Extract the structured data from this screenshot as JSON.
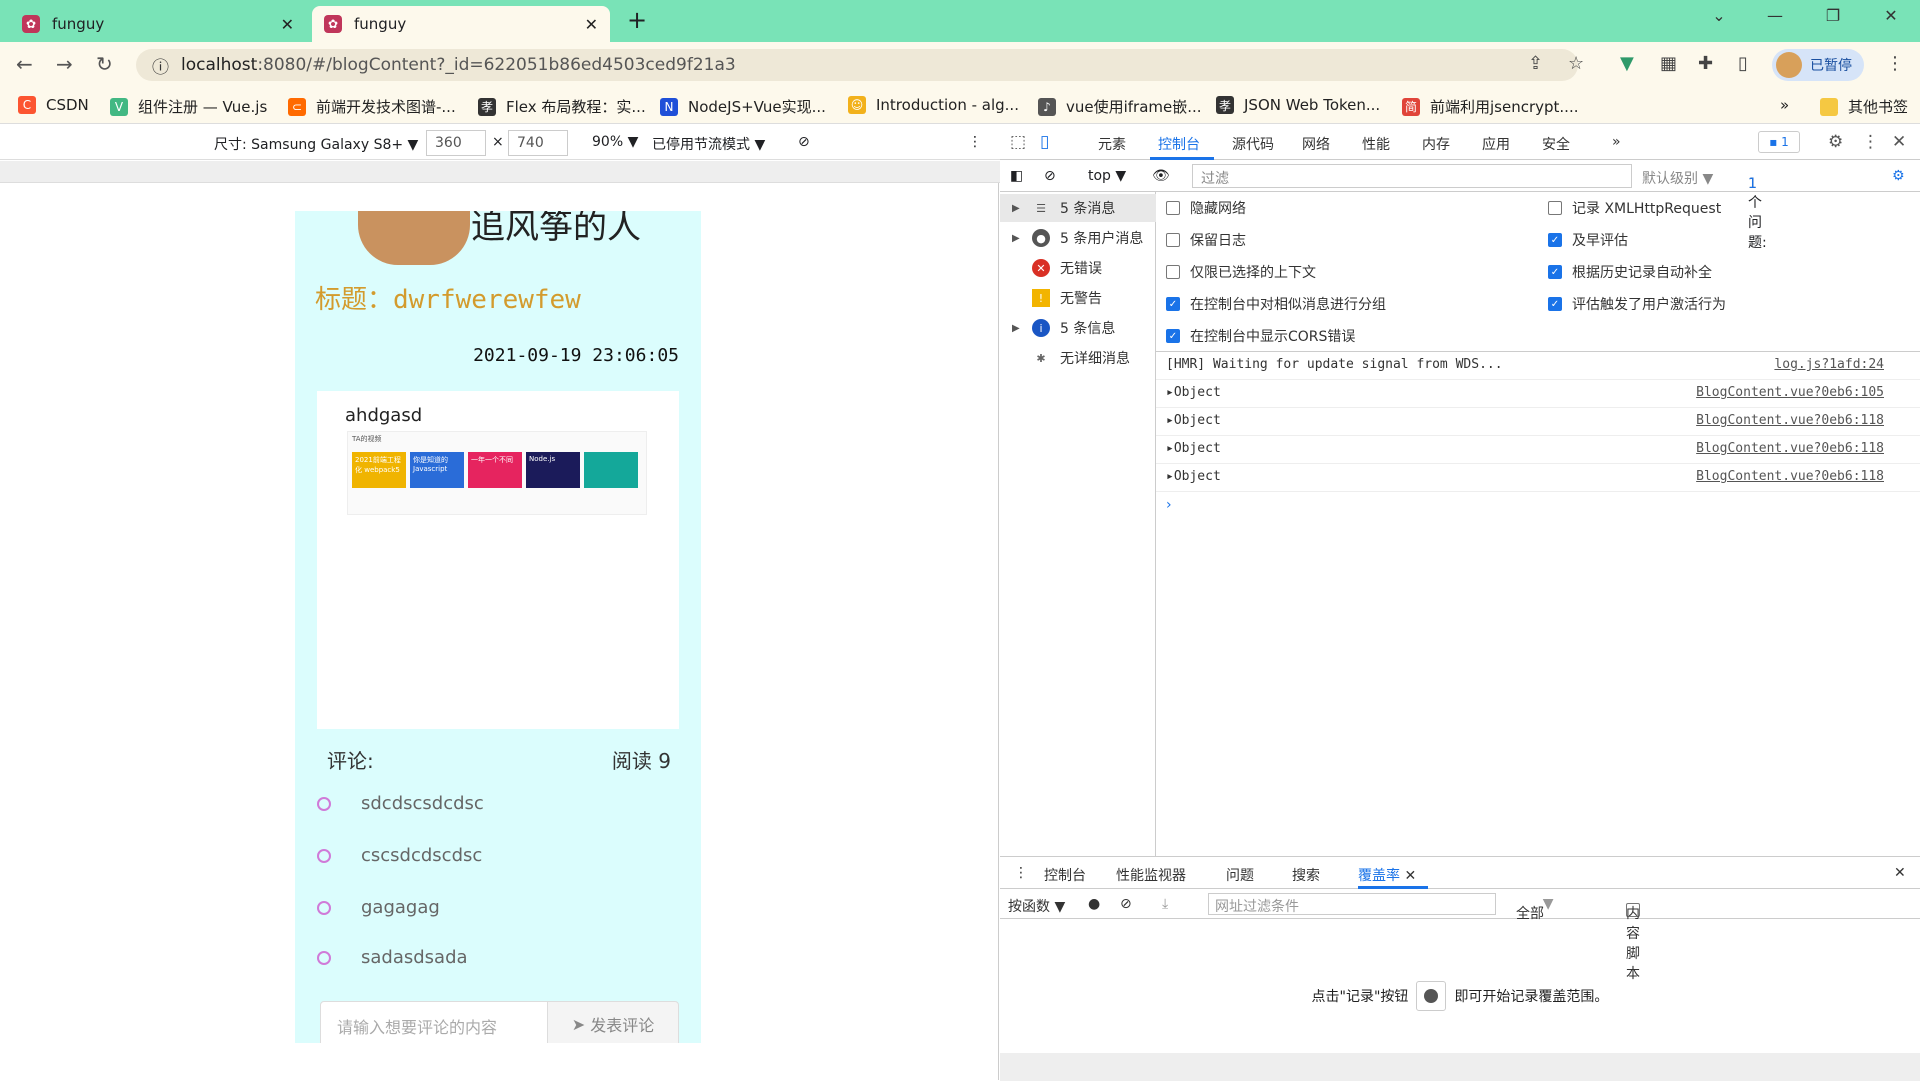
{
  "browser": {
    "tabs": [
      {
        "title": "funguy",
        "active": false
      },
      {
        "title": "funguy",
        "active": true
      }
    ],
    "url_host": "localhost",
    "url_path": ":8080/#/blogContent?_id=622051b86ed4503ced9f21a3",
    "profile_label": "已暂停",
    "bookmarks": [
      {
        "label": "CSDN",
        "color": "#fc5531"
      },
      {
        "label": "组件注册 — Vue.js",
        "color": "#42b883"
      },
      {
        "label": "前端开发技术图谱-...",
        "color": "#ff6a00"
      },
      {
        "label": "Flex 布局教程：实...",
        "color": "#333333"
      },
      {
        "label": "NodeJS+Vue实现...",
        "color": "#1f4fd8"
      },
      {
        "label": "Introduction - alg...",
        "color": "#f2b11b"
      },
      {
        "label": "vue使用iframe嵌...",
        "color": "#555555"
      },
      {
        "label": "JSON Web Token...",
        "color": "#333333"
      },
      {
        "label": "前端利用jsencrypt....",
        "color": "#e0453a"
      }
    ],
    "bookmarks_more": "»",
    "other_bookmarks": "其他书签"
  },
  "device_toolbar": {
    "device": "尺寸: Samsung Galaxy S8+ ▼",
    "width": "360",
    "height": "740",
    "times": "×",
    "zoom": "90% ▼",
    "throttle": "已停用节流模式 ▼"
  },
  "blog": {
    "author": "追风筝的人",
    "title": "标题：dwrfwerewfew",
    "date": "2021-09-19 23:06:05",
    "content_text": "ahdgasd",
    "comments_label": "评论:",
    "reads": "阅读 9",
    "comments": [
      "sdcdscsdcdsc",
      "cscsdcdscdsc",
      "gagagag",
      "sadasdsada"
    ],
    "input_placeholder": "请输入想要评论的内容",
    "submit_label": "发表评论",
    "thumb_header": "TA的视频",
    "thumbs": [
      {
        "label": "2021前端工程化 webpack5",
        "color": "#f0b400"
      },
      {
        "label": "你是知道的 Javascript",
        "color": "#2a6cd8"
      },
      {
        "label": "一年一个不同",
        "color": "#e6245f"
      },
      {
        "label": "Node.js",
        "color": "#1b1b5a"
      },
      {
        "label": "",
        "color": "#14a89a"
      }
    ]
  },
  "devtools": {
    "tabs": [
      "元素",
      "控制台",
      "源代码",
      "网络",
      "性能",
      "内存",
      "应用",
      "安全",
      "»"
    ],
    "issues_badge": "1",
    "context": "top ▼",
    "filter_placeholder": "过滤",
    "level": "默认级别 ▼",
    "issue_count": "1 个问题: ",
    "issue_num": "1",
    "sidebar": [
      {
        "label": "5 条消息",
        "icon": "list-icon",
        "color": "#555555"
      },
      {
        "label": "5 条用户消息",
        "icon": "user-icon",
        "color": "#555555"
      },
      {
        "label": "无错误",
        "icon": "error-icon",
        "color": "#d93025"
      },
      {
        "label": "无警告",
        "icon": "warning-icon",
        "color": "#f2b400"
      },
      {
        "label": "5 条信息",
        "icon": "info-icon",
        "color": "#1a56c4"
      },
      {
        "label": "无详细消息",
        "icon": "bug-icon",
        "color": "#666666"
      }
    ],
    "settings_left": [
      {
        "label": "隐藏网络",
        "checked": false
      },
      {
        "label": "保留日志",
        "checked": false
      },
      {
        "label": "仅限已选择的上下文",
        "checked": false
      },
      {
        "label": "在控制台中对相似消息进行分组",
        "checked": true
      },
      {
        "label": "在控制台中显示CORS错误",
        "checked": true
      }
    ],
    "settings_right": [
      {
        "label": "记录 XMLHttpRequest",
        "checked": false
      },
      {
        "label": "及早评估",
        "checked": true
      },
      {
        "label": "根据历史记录自动补全",
        "checked": true
      },
      {
        "label": "评估触发了用户激活行为",
        "checked": true
      }
    ],
    "logs": [
      {
        "text": "[HMR] Waiting for update signal from WDS...",
        "source": "log.js?1afd:24",
        "expandable": false
      },
      {
        "text": "Object",
        "source": "BlogContent.vue?0eb6:105",
        "expandable": true
      },
      {
        "text": "Object",
        "source": "BlogContent.vue?0eb6:118",
        "expandable": true
      },
      {
        "text": "Object",
        "source": "BlogContent.vue?0eb6:118",
        "expandable": true
      },
      {
        "text": "Object",
        "source": "BlogContent.vue?0eb6:118",
        "expandable": true
      }
    ],
    "prompt": "›",
    "drawer_tabs": [
      "控制台",
      "性能监视器",
      "问题",
      "搜索",
      "覆盖率"
    ],
    "coverage_mode": "按函数 ▼",
    "url_filter_placeholder": "网址过滤条件",
    "coverage_type": "全部",
    "content_scripts": "内容脚本",
    "empty_text_before": "点击\"记录\"按钮",
    "empty_text_after": "即可开始记录覆盖范围。"
  }
}
